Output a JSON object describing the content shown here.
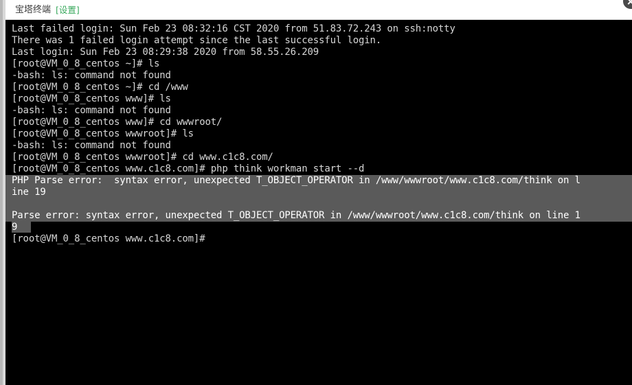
{
  "window": {
    "title": "宝塔终端",
    "settings_label": "[设置]",
    "close_icon": "close-icon"
  },
  "terminal": {
    "background": "#000000",
    "foreground": "#d6d6d6",
    "selection_background": "#5a5a5a",
    "host": "VM_0_8_centos",
    "user": "root",
    "lines": [
      {
        "text": "Last failed login: Sun Feb 23 08:32:16 CST 2020 from 51.83.72.243 on ssh:notty",
        "selected": "none"
      },
      {
        "text": "There was 1 failed login attempt since the last successful login.",
        "selected": "none"
      },
      {
        "text": "Last login: Sun Feb 23 08:29:38 2020 from 58.55.26.209",
        "selected": "none"
      },
      {
        "text": "[root@VM_0_8_centos ~]# ls",
        "selected": "none"
      },
      {
        "text": "-bash: ls: command not found",
        "selected": "none"
      },
      {
        "text": "[root@VM_0_8_centos ~]# cd /www",
        "selected": "none"
      },
      {
        "text": "[root@VM_0_8_centos www]# ls",
        "selected": "none"
      },
      {
        "text": "-bash: ls: command not found",
        "selected": "none"
      },
      {
        "text": "[root@VM_0_8_centos www]# cd wwwroot/",
        "selected": "none"
      },
      {
        "text": "[root@VM_0_8_centos wwwroot]# ls",
        "selected": "none"
      },
      {
        "text": "-bash: ls: command not found",
        "selected": "none"
      },
      {
        "text": "[root@VM_0_8_centos wwwroot]# cd www.c1c8.com/",
        "selected": "none"
      },
      {
        "text": "[root@VM_0_8_centos www.c1c8.com]# php think workman start --d",
        "selected": "none"
      },
      {
        "text": "PHP Parse error:  syntax error, unexpected T_OBJECT_OPERATOR in /www/wwwroot/www.c1c8.com/think on l",
        "selected": "full"
      },
      {
        "text": "ine 19",
        "selected": "full"
      },
      {
        "text": "",
        "selected": "full"
      },
      {
        "text": "Parse error: syntax error, unexpected T_OBJECT_OPERATOR in /www/wwwroot/www.c1c8.com/think on line 1",
        "selected": "full"
      },
      {
        "text": "9",
        "selected": "partial"
      },
      {
        "text": "[root@VM_0_8_centos www.c1c8.com]# ",
        "selected": "none"
      }
    ]
  }
}
